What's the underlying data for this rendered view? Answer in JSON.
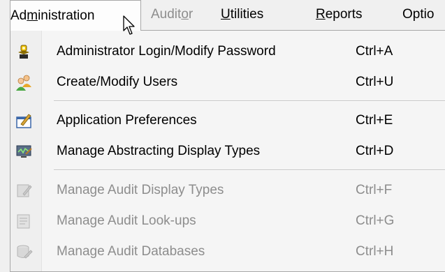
{
  "menubar": {
    "administration": {
      "pre": "Ad",
      "ul": "m",
      "post": "inistration"
    },
    "auditor": {
      "pre": "Audit",
      "ul": "o",
      "post": "r"
    },
    "utilities": {
      "pre": "",
      "ul": "U",
      "post": "tilities"
    },
    "reports": {
      "pre": "",
      "ul": "R",
      "post": "eports"
    },
    "options": {
      "text": "Optio"
    }
  },
  "menu": {
    "items": [
      {
        "label": "Administrator Login/Modify Password",
        "shortcut": "Ctrl+A",
        "icon": "admin-key-icon",
        "enabled": true
      },
      {
        "label": "Create/Modify Users",
        "shortcut": "Ctrl+U",
        "icon": "users-icon",
        "enabled": true
      },
      {
        "label": "Application Preferences",
        "shortcut": "Ctrl+E",
        "icon": "preferences-icon",
        "enabled": true
      },
      {
        "label": "Manage Abstracting Display Types",
        "shortcut": "Ctrl+D",
        "icon": "display-types-icon",
        "enabled": true
      },
      {
        "label": "Manage Audit Display Types",
        "shortcut": "Ctrl+F",
        "icon": "audit-display-icon",
        "enabled": false
      },
      {
        "label": "Manage Audit Look-ups",
        "shortcut": "Ctrl+G",
        "icon": "audit-lookups-icon",
        "enabled": false
      },
      {
        "label": "Manage Audit Databases",
        "shortcut": "Ctrl+H",
        "icon": "audit-databases-icon",
        "enabled": false
      }
    ]
  },
  "colors": {
    "enabled_text": "#000000",
    "disabled_text": "#8d8d8d",
    "menu_bg": "#f5f5f5"
  }
}
